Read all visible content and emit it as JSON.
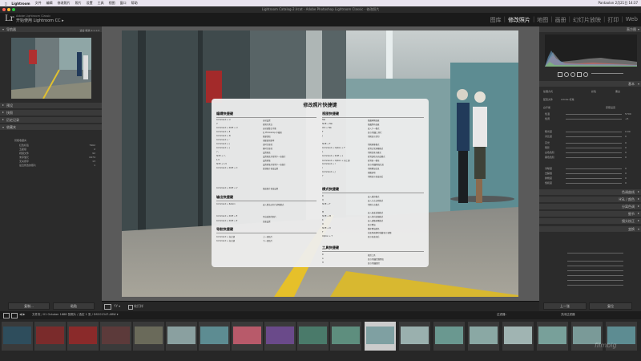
{
  "menubar": {
    "items": [
      "Lightroom",
      "文件",
      "编辑",
      "修改照片",
      "照片",
      "设置",
      "工具",
      "视图",
      "窗口",
      "帮助"
    ],
    "right": "Pantaolon 2月21日 14:37"
  },
  "title_strip": "Lightroom Catalog-2.lrcat - Adobe Photoshop Lightroom Classic - 修改照片",
  "identity": {
    "logo": "Lr",
    "subtitle": "Adobe Lightroom Classic",
    "name": "开始使用 Lightroom CC ▸"
  },
  "modules": [
    "图库",
    "修改照片",
    "地图",
    "画册",
    "幻灯片放映",
    "打印",
    "Web"
  ],
  "left_panel": {
    "navigator": "导航器",
    "nav_zoom": "适合 填满 1:1 1:3",
    "presets": "预设",
    "snapshots": "快照",
    "history": "历史记录",
    "collections": "收藏夹",
    "collection_items": [
      {
        "label": "智能收藏夹",
        "count": ""
      },
      {
        "label": "红色标签",
        "count": "7962"
      },
      {
        "label": "五星级",
        "count": "2"
      },
      {
        "label": "视频文件",
        "count": "92"
      },
      {
        "label": "未存储元",
        "count": "6474"
      },
      {
        "label": "无关键字",
        "count": "13"
      },
      {
        "label": "最近修改的照片",
        "count": "1"
      }
    ],
    "copy_btn": "复制...",
    "paste_btn": "粘贴"
  },
  "shortcuts": {
    "title": "修改照片快捷键",
    "edit_title": "编辑快捷键",
    "edit_rows": [
      [
        "Command + U",
        "自动设置"
      ],
      [
        "V",
        "转换为黑白"
      ],
      [
        "Command + Shift + U",
        "自动调整白平衡"
      ],
      [
        "Command + E",
        "在 Photoshop 中编辑"
      ],
      [
        "Command + N",
        "新建快照"
      ],
      [
        "Command + '",
        "创建虚拟副本"
      ],
      [
        "Command + [",
        "逆时针旋转"
      ],
      [
        "Command + ]",
        "顺时针旋转"
      ],
      [
        "/ \\",
        "设置预览"
      ],
      [
        "Shift + / \\",
        "设置预览并带到下一张照片"
      ],
      [
        "1-5",
        "设置星级"
      ],
      [
        "Shift + 1-5",
        "设置星级并带到下一张照片"
      ],
      [
        "Command + Shift + C",
        "复制照片修改设置"
      ],
      [
        "Command + Shift + V",
        "粘贴照片修改设置"
      ]
    ],
    "output_title": "输出快捷键",
    "output_rows": [
      [
        "Command + Return",
        "进入简洁幻灯片放映模式"
      ],
      [
        "Command + Shift + E",
        "导出选择的照片"
      ],
      [
        "Command + Shift + P",
        "页面设置"
      ]
    ],
    "nav_title": "导航快捷键",
    "nav_rows": [
      [
        "Command + 向左键",
        "上一张照片"
      ],
      [
        "Command + 向右键",
        "下一张照片"
      ]
    ],
    "view_title": "视图快捷键",
    "view_rows": [
      [
        "Tab",
        "隐藏两侧面板"
      ],
      [
        "Shift + Tab",
        "隐藏所有面板"
      ],
      [
        "Ctrl + Tab",
        "进入下一模式"
      ],
      [
        "F",
        "显示/隐藏工具栏"
      ],
      [
        "J",
        "切换显示剪切"
      ],
      [
        "Shift + F",
        "切换屏幕模式"
      ],
      [
        "Command + Option + F",
        "转到正常屏幕模式"
      ],
      [
        "L",
        "切换背景光模式"
      ],
      [
        "Command + Shift + L",
        "转到变暗光亮度模式"
      ],
      [
        "Command + Option + 向上键",
        "转到前一模块"
      ],
      [
        "Command + I",
        "显示/隐藏叠加信息"
      ],
      [
        "I",
        "切换叠加信息"
      ],
      [
        "Command + J",
        "视图选项"
      ],
      [
        "Y",
        "切换显示修改前后"
      ]
    ],
    "mode_title": "模式快捷键",
    "mode_rows": [
      [
        "R",
        "进入裁剪模式"
      ],
      [
        "Q",
        "进入污点去除模式"
      ],
      [
        "Shift + T",
        "切换污点模式"
      ],
      [
        "M",
        "进入渐变滤镜模式"
      ],
      [
        "Shift + M",
        "进入径向滤镜模式"
      ],
      [
        "K",
        "进入调整画笔模式"
      ],
      [
        "O",
        "显示叠加"
      ],
      [
        "Shift + O",
        "循环叠加颜色"
      ],
      [
        "T",
        "在使用画笔时隐藏/显示调整"
      ],
      [
        "Option + T",
        "显示修改前后"
      ]
    ],
    "tool_title": "工具快捷键",
    "tool_rows": [
      [
        "R",
        "裁剪工具"
      ],
      [
        "A",
        "显示/隐藏蒙版叠加"
      ],
      [
        "H",
        "显示/隐藏图钉"
      ]
    ]
  },
  "right_panel": {
    "histogram": "直方图",
    "basic": "基本",
    "treatment_label": "处理方式",
    "treatment_color": "彩色",
    "treatment_bw": "黑白",
    "profile_label": "配置文件",
    "profile_value": "Adobe 标准",
    "wb_label": "白平衡",
    "wb_value": "原照设置",
    "sliders": [
      {
        "name": "色温",
        "value": "5700"
      },
      {
        "name": "色调",
        "value": "+5"
      },
      {
        "name": "曝光度",
        "value": "0.00"
      },
      {
        "name": "对比度",
        "value": "0"
      },
      {
        "name": "高光",
        "value": "0"
      },
      {
        "name": "阴影",
        "value": "0"
      },
      {
        "name": "白色色阶",
        "value": "0"
      },
      {
        "name": "黑色色阶",
        "value": "0"
      },
      {
        "name": "清晰度",
        "value": "0"
      },
      {
        "name": "去朦胧",
        "value": "0"
      },
      {
        "name": "鲜艳度",
        "value": "0"
      },
      {
        "name": "饱和度",
        "value": "0"
      }
    ],
    "sections": [
      "色调曲线",
      "HSL / 颜色",
      "分离色调",
      "细节",
      "镜头校正",
      "变换"
    ],
    "prev_btn": "上一张",
    "reset_btn": "复位"
  },
  "toolbar": {
    "softproof": "软打样"
  },
  "filmbar": {
    "info": "文件夹 / 01 October   1688 张照片 / 选定 1 张 / DSC01347.ARW ▾",
    "filter": "过滤器：",
    "filter_value": "关闭过滤器"
  },
  "watermark": "filmbig"
}
